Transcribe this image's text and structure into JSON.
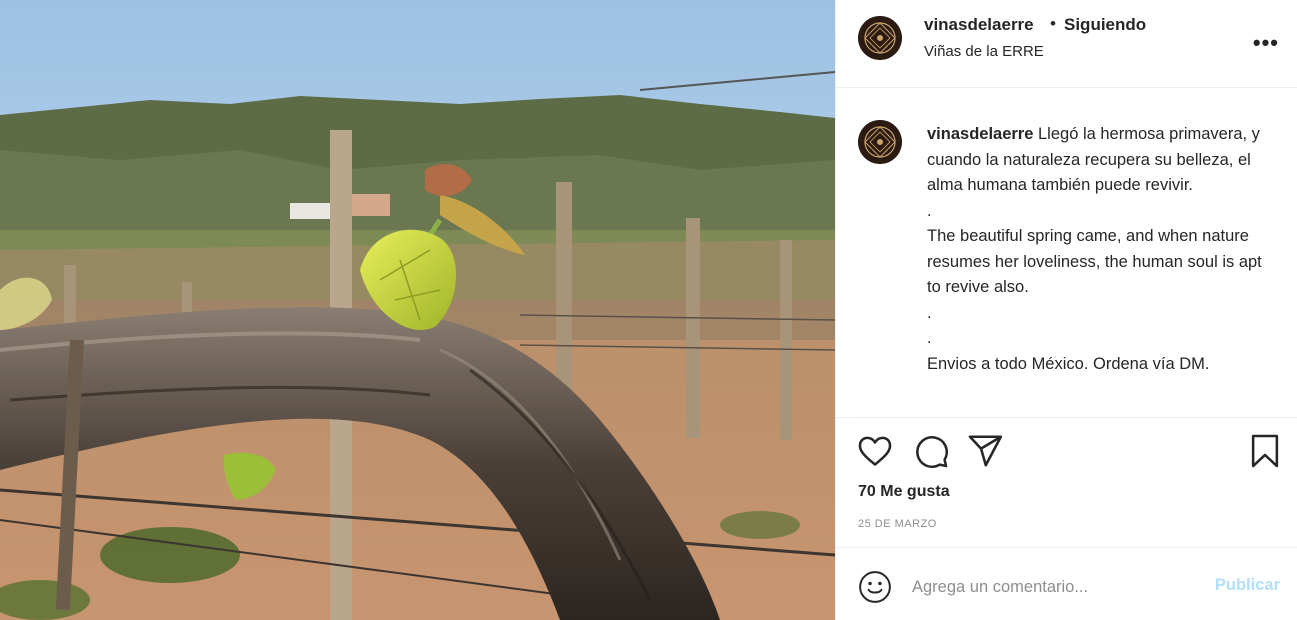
{
  "post": {
    "username": "vinasdelaerre",
    "separator": "•",
    "follow_status": "Siguiendo",
    "location": "Viñas de la ERRE",
    "more_label": "•••"
  },
  "caption": {
    "username": "vinasdelaerre",
    "lines": [
      "Llegó la hermosa primavera, y cuando la naturaleza recupera su belleza, el alma humana también puede revivir.",
      ".",
      "The beautiful spring came, and when nature resumes her loveliness, the human soul is apt to revive also.",
      ".",
      ".",
      "Envios a todo México. Ordena vía DM."
    ]
  },
  "stats": {
    "likes": "70 Me gusta",
    "date": "25 DE MARZO"
  },
  "comment": {
    "placeholder": "Agrega un comentario...",
    "publish_label": "Publicar"
  },
  "icons": {
    "like": "heart-icon",
    "comment": "comment-bubble-icon",
    "share": "paper-plane-icon",
    "save": "bookmark-icon",
    "emoji": "smiley-icon"
  },
  "colors": {
    "text": "#262626",
    "secondary": "#8e8e8e",
    "publish_disabled": "#b2dffc",
    "border": "#efefef"
  }
}
